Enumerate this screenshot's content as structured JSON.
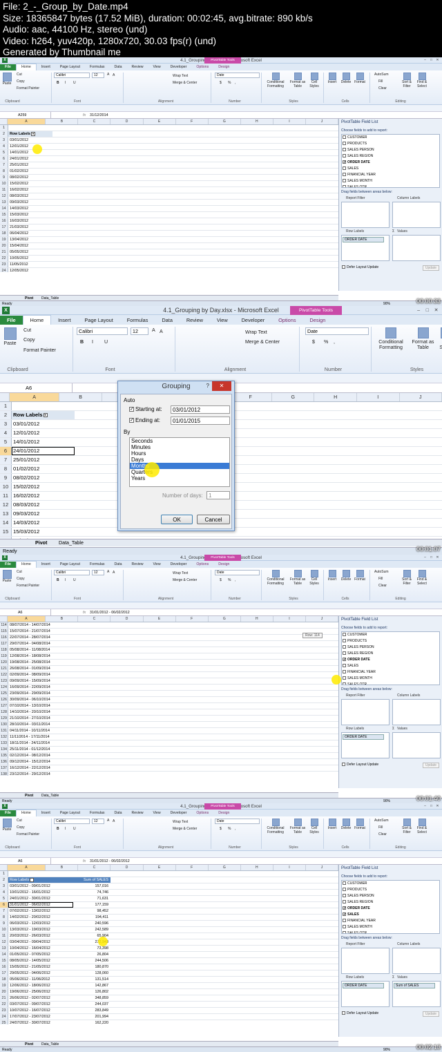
{
  "header": {
    "line1": "File: 2_-_Group_by_Date.mp4",
    "line2": "Size: 18365847 bytes (17.52 MiB), duration: 00:02:45, avg.bitrate: 890 kb/s",
    "line3": "Audio: aac, 44100 Hz, stereo (und)",
    "line4": "Video: h264, yuv420p, 1280x720, 30.03 fps(r) (und)",
    "line5": "Generated by Thumbnail me"
  },
  "app": {
    "title": "4.1_Grouping by Day.xlsx - Microsoft Excel",
    "xl": "X",
    "pivot_tools": "PivotTable Tools",
    "min": "–",
    "max": "□",
    "close": "✕"
  },
  "tabs": [
    "File",
    "Home",
    "Insert",
    "Page Layout",
    "Formulas",
    "Data",
    "Review",
    "View",
    "Developer",
    "Options",
    "Design"
  ],
  "ribbon": {
    "paste": "Paste",
    "cut": "Cut",
    "copy": "Copy",
    "format_painter": "Format Painter",
    "clipboard": "Clipboard",
    "font_name": "Calibri",
    "font_size": "12",
    "grow": "A",
    "shrink": "A",
    "bold": "B",
    "italic": "I",
    "underline": "U",
    "font": "Font",
    "wrap": "Wrap Text",
    "merge": "Merge & Center",
    "alignment": "Alignment",
    "number_format": "Date",
    "currency": "$",
    "percent": "%",
    "comma": ",",
    "number": "Number",
    "cond_fmt": "Conditional Formatting",
    "fmt_table": "Format as Table",
    "cell_styles": "Cell Styles",
    "styles": "Styles",
    "insert": "Insert",
    "delete": "Delete",
    "format": "Format",
    "cells": "Cells",
    "autosum": "AutoSum",
    "fill": "Fill",
    "clear": "Clear",
    "sort": "Sort & Filter",
    "find": "Find & Select",
    "editing": "Editing"
  },
  "formula": {
    "fx": "fx"
  },
  "cols": [
    "A",
    "B",
    "C",
    "D",
    "E",
    "F",
    "G",
    "H",
    "I",
    "J"
  ],
  "pivot_panel": {
    "title": "PivotTable Field List",
    "choose": "Choose fields to add to report:",
    "fields": [
      "CUSTOMER",
      "PRODUCTS",
      "SALES PERSON",
      "SALES REGION",
      "ORDER DATE",
      "SALES",
      "FINANCIAL YEAR",
      "SALES MONTH",
      "SALES QTR"
    ],
    "drag": "Drag fields between areas below:",
    "report_filter": "Report Filter",
    "column_labels": "Column Labels",
    "row_labels": "Row Labels",
    "values": "Values",
    "values_sym": "Σ",
    "row_chip": "ORDER DATE",
    "values_chip": "Sum of SALES",
    "defer": "Defer Layout Update",
    "update": "Update"
  },
  "sheets": {
    "pivot": "Pivot",
    "data": "Data_Table"
  },
  "status": {
    "ready": "Ready",
    "zoom": "90%"
  },
  "frame1": {
    "namebox": "A259",
    "formula": "31/12/2014",
    "header": "Row Labels",
    "rows": [
      "03/01/2012",
      "12/01/2012",
      "14/01/2012",
      "24/01/2012",
      "25/01/2012",
      "01/02/2012",
      "08/02/2012",
      "15/02/2012",
      "16/02/2012",
      "08/03/2012",
      "09/03/2012",
      "14/03/2012",
      "15/03/2012",
      "16/03/2012",
      "21/03/2012",
      "06/04/2012",
      "13/04/2012",
      "15/04/2012",
      "05/05/2012",
      "10/05/2012",
      "11/05/2012",
      "12/05/2012",
      "16/05/2012"
    ],
    "timestamp": "00:00:33"
  },
  "frame2": {
    "namebox": "A6",
    "header": "Row Labels",
    "rows": [
      "03/01/2012",
      "12/01/2012",
      "14/01/2012",
      "24/01/2012",
      "25/01/2012",
      "01/02/2012",
      "08/02/2012",
      "15/02/2012",
      "16/02/2012",
      "08/03/2012",
      "09/03/2012",
      "14/03/2012",
      "15/03/2012",
      "16/03/2012"
    ],
    "timestamp": "00:01:07",
    "dialog": {
      "title": "Grouping",
      "help": "?",
      "close": "✕",
      "auto": "Auto",
      "start_label": "Starting at:",
      "start_value": "03/01/2012",
      "end_label": "Ending at:",
      "end_value": "01/01/2015",
      "by": "By",
      "options": [
        "Seconds",
        "Minutes",
        "Hours",
        "Days",
        "Months",
        "Quarters",
        "Years"
      ],
      "selected": "Months",
      "days_label": "Number of days:",
      "days_value": "1",
      "ok": "OK",
      "cancel": "Cancel"
    }
  },
  "frame3": {
    "namebox": "A6",
    "formula": "31/01/2012 - 06/02/2012",
    "tooltip": "Row: 114",
    "rownums": [
      "114",
      "115",
      "116",
      "117",
      "118",
      "119",
      "120",
      "121",
      "122",
      "123",
      "124",
      "125",
      "126",
      "127",
      "128",
      "129",
      "130",
      "131",
      "132",
      "133",
      "134",
      "135",
      "136",
      "137"
    ],
    "rows": [
      "08/07/2014 - 14/07/2014",
      "15/07/2014 - 21/07/2014",
      "22/07/2014 - 28/07/2014",
      "29/07/2014 - 04/08/2014",
      "05/08/2014 - 11/08/2014",
      "12/08/2014 - 18/08/2014",
      "19/08/2014 - 25/08/2014",
      "26/08/2014 - 01/09/2014",
      "02/09/2014 - 08/09/2014",
      "09/09/2014 - 15/09/2014",
      "16/09/2014 - 22/09/2014",
      "23/09/2014 - 29/09/2014",
      "30/09/2014 - 06/10/2014",
      "07/10/2014 - 13/10/2014",
      "14/10/2014 - 20/10/2014",
      "21/10/2014 - 27/10/2014",
      "28/10/2014 - 03/11/2014",
      "04/11/2014 - 10/11/2014",
      "11/11/2014 - 17/11/2014",
      "18/11/2014 - 24/11/2014",
      "25/11/2014 - 01/12/2014",
      "02/12/2014 - 08/12/2014",
      "09/12/2014 - 15/12/2014",
      "16/12/2014 - 22/12/2014",
      "23/12/2014 - 29/12/2014",
      "30/12/2014 - 01/01/2015",
      "Grand Total"
    ],
    "timestamp": "00:01:40"
  },
  "frame4": {
    "namebox": "A6",
    "formula": "31/01/2012 - 06/02/2012",
    "header": "Row Labels",
    "header2": "Sum of SALES",
    "rows": [
      [
        "03/01/2012 - 09/01/2012",
        "157,016"
      ],
      [
        "10/01/2012 - 16/01/2012",
        "74,746"
      ],
      [
        "24/01/2012 - 30/01/2012",
        "71,631"
      ],
      [
        "31/01/2012 - 06/02/2012",
        "177,159"
      ],
      [
        "07/02/2012 - 13/02/2012",
        "98,452"
      ],
      [
        "14/02/2012 - 20/02/2012",
        "194,411"
      ],
      [
        "06/03/2012 - 12/03/2012",
        "240,596"
      ],
      [
        "13/03/2012 - 19/03/2012",
        "242,589"
      ],
      [
        "20/03/2012 - 26/03/2012",
        "65,904"
      ],
      [
        "03/04/2012 - 09/04/2012",
        "272,943"
      ],
      [
        "10/04/2012 - 16/04/2012",
        "73,398"
      ],
      [
        "01/05/2012 - 07/05/2012",
        "26,804"
      ],
      [
        "08/05/2012 - 14/05/2012",
        "244,506"
      ],
      [
        "15/05/2012 - 21/05/2012",
        "180,870"
      ],
      [
        "29/05/2012 - 04/06/2012",
        "128,060"
      ],
      [
        "05/06/2012 - 11/06/2012",
        "131,514"
      ],
      [
        "12/06/2012 - 18/06/2012",
        "142,867"
      ],
      [
        "19/06/2012 - 25/06/2012",
        "126,802"
      ],
      [
        "26/06/2012 - 02/07/2012",
        "348,859"
      ],
      [
        "03/07/2012 - 09/07/2012",
        "244,037"
      ],
      [
        "10/07/2012 - 16/07/2012",
        "283,849"
      ],
      [
        "17/07/2012 - 23/07/2012",
        "201,994"
      ],
      [
        "24/07/2012 - 30/07/2012",
        "162,220"
      ]
    ],
    "timestamp": "00:02:13"
  }
}
